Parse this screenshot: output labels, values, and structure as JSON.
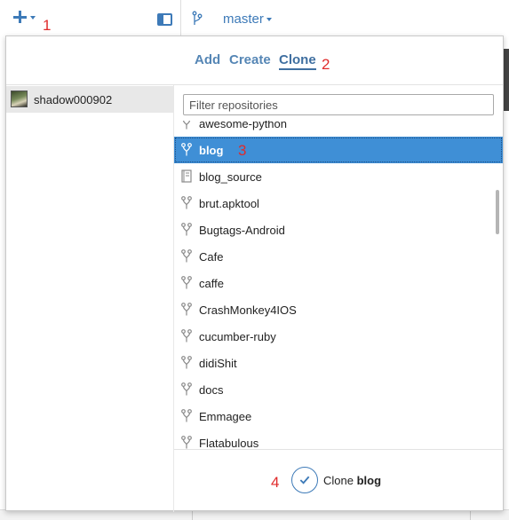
{
  "toolbar": {
    "add_icon": "plus-icon",
    "sidebar_toggle_icon": "sidebar-icon",
    "branch_icon": "branch-icon",
    "branch": "master"
  },
  "annotations": [
    "1",
    "2",
    "3",
    "4"
  ],
  "popover": {
    "tabs": [
      {
        "label": "Add"
      },
      {
        "label": "Create"
      },
      {
        "label": "Clone",
        "active": true
      }
    ],
    "account": {
      "name": "shadow000902"
    },
    "filter_placeholder": "Filter repositories",
    "repos": [
      {
        "name": "awesome-python",
        "icon": "fork-icon"
      },
      {
        "name": "blog",
        "icon": "fork-icon",
        "selected": true
      },
      {
        "name": "blog_source",
        "icon": "repo-icon"
      },
      {
        "name": "brut.apktool",
        "icon": "fork-icon"
      },
      {
        "name": "Bugtags-Android",
        "icon": "fork-icon"
      },
      {
        "name": "Cafe",
        "icon": "fork-icon"
      },
      {
        "name": "caffe",
        "icon": "fork-icon"
      },
      {
        "name": "CrashMonkey4IOS",
        "icon": "fork-icon"
      },
      {
        "name": "cucumber-ruby",
        "icon": "fork-icon"
      },
      {
        "name": "didiShit",
        "icon": "fork-icon"
      },
      {
        "name": "docs",
        "icon": "fork-icon"
      },
      {
        "name": "Emmagee",
        "icon": "fork-icon"
      },
      {
        "name": "Flatabulous",
        "icon": "fork-icon"
      }
    ],
    "clone_button": {
      "prefix": "Clone",
      "repo": "blog",
      "icon": "checkmark-icon"
    }
  },
  "colors": {
    "accent": "#3d7ab8",
    "selection": "#3f8fd6",
    "annotation": "#e02b2b"
  }
}
